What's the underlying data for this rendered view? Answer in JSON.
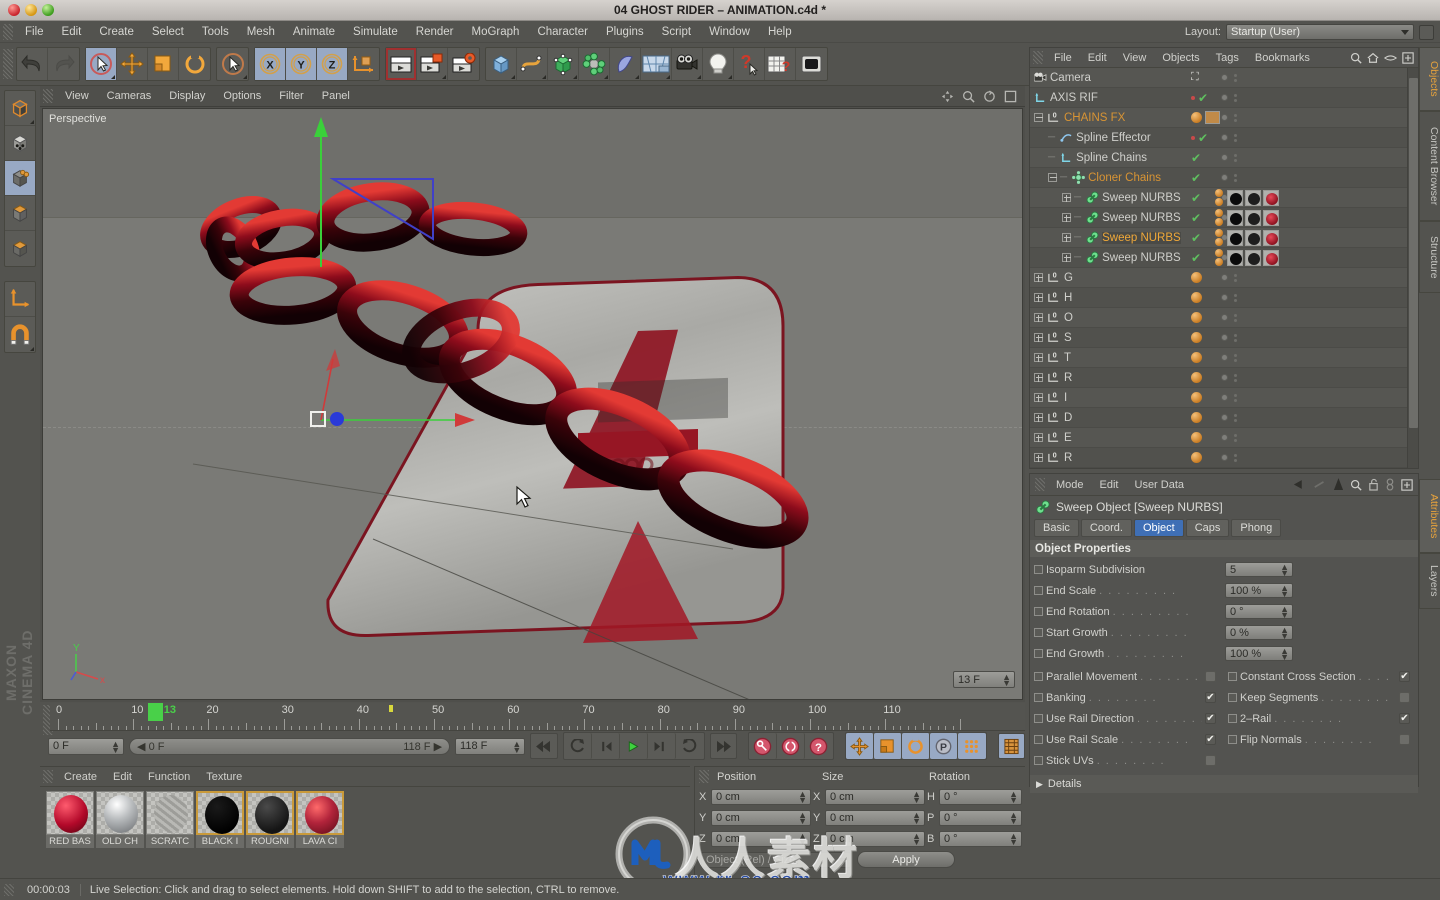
{
  "window": {
    "title": "04 GHOST RIDER – ANIMATION.c4d *",
    "traffic_lights": [
      "close",
      "minimize",
      "zoom"
    ]
  },
  "menubar": {
    "items": [
      "File",
      "Edit",
      "Create",
      "Select",
      "Tools",
      "Mesh",
      "Animate",
      "Simulate",
      "Render",
      "MoGraph",
      "Character",
      "Plugins",
      "Script",
      "Window",
      "Help"
    ],
    "layout_label": "Layout:",
    "layout_value": "Startup (User)"
  },
  "toolbar": {
    "groups": [
      {
        "name": "history",
        "buttons": [
          {
            "icon": "undo-icon",
            "label": "Undo",
            "selected": false
          },
          {
            "icon": "redo-icon",
            "label": "Redo",
            "selected": false
          }
        ]
      },
      {
        "name": "tools",
        "buttons": [
          {
            "icon": "live-selection-icon",
            "label": "Live Selection",
            "selected": true
          },
          {
            "icon": "move-icon",
            "label": "Move",
            "selected": false
          },
          {
            "icon": "scale-icon",
            "label": "Scale",
            "selected": false
          },
          {
            "icon": "rotate-icon",
            "label": "Rotate",
            "selected": false
          }
        ]
      },
      {
        "name": "selection",
        "buttons": [
          {
            "icon": "selection-mode-icon",
            "label": "Selection Mode",
            "selected": false
          }
        ]
      },
      {
        "name": "axis-lock",
        "buttons": [
          {
            "icon": "x-axis-icon",
            "label": "X Axis",
            "selected": true
          },
          {
            "icon": "y-axis-icon",
            "label": "Y Axis",
            "selected": true
          },
          {
            "icon": "z-axis-icon",
            "label": "Z Axis",
            "selected": true
          },
          {
            "icon": "world-coordinates-icon",
            "label": "World / Object Coordinates",
            "selected": false
          }
        ]
      },
      {
        "name": "render",
        "buttons": [
          {
            "icon": "render-view-icon",
            "label": "Render View",
            "selected": false
          },
          {
            "icon": "render-region-icon",
            "label": "Render to Picture Viewer",
            "selected": false
          },
          {
            "icon": "render-settings-icon",
            "label": "Render Settings",
            "selected": false
          }
        ]
      },
      {
        "name": "create",
        "buttons": [
          {
            "icon": "cube-primitive-icon",
            "label": "Add Cube Object",
            "selected": false
          },
          {
            "icon": "spline-icon",
            "label": "Add Spline",
            "selected": false
          },
          {
            "icon": "nurbs-icon",
            "label": "Add NURBS Object",
            "selected": false
          },
          {
            "icon": "array-icon",
            "label": "Add Modeling Object",
            "selected": false
          },
          {
            "icon": "deformer-icon",
            "label": "Add Deformer Object",
            "selected": false
          },
          {
            "icon": "scene-icon",
            "label": "Add Scene Object",
            "selected": false
          },
          {
            "icon": "camera-icon",
            "label": "Add Camera",
            "selected": false
          },
          {
            "icon": "light-icon",
            "label": "Add Light",
            "selected": false
          },
          {
            "icon": "help-cursor-icon",
            "label": "Context Help",
            "selected": false
          },
          {
            "icon": "table-help-icon",
            "label": "Table Help",
            "selected": false
          },
          {
            "icon": "content-folder-icon",
            "label": "Content Browser",
            "selected": false
          }
        ]
      }
    ]
  },
  "leftbar": {
    "groups": [
      {
        "buttons": [
          {
            "icon": "model-mode-icon",
            "label": "Model Mode",
            "selected": false
          },
          {
            "icon": "points-mode-icon",
            "label": "Points Mode",
            "selected": false
          },
          {
            "icon": "edges-mode-icon",
            "label": "Edges Mode",
            "selected": true
          },
          {
            "icon": "polygons-mode-icon",
            "label": "Polygons Mode",
            "selected": false
          },
          {
            "icon": "texture-mode-icon",
            "label": "Texture Mode",
            "selected": false
          }
        ]
      },
      {
        "buttons": [
          {
            "icon": "axis-modify-icon",
            "label": "Enable Axis Modification",
            "selected": false
          },
          {
            "icon": "magnet-icon",
            "label": "Snap Settings",
            "selected": false
          }
        ]
      }
    ],
    "branding": "MAXON CINEMA 4D"
  },
  "viewport": {
    "menu": [
      "View",
      "Cameras",
      "Display",
      "Options",
      "Filter",
      "Panel"
    ],
    "label": "Perspective",
    "nav_icons": [
      "pan-icon",
      "zoom-icon",
      "rotate-icon",
      "maximize-icon"
    ],
    "scene_description": "Red chain links passing through a grey metal letter A logo"
  },
  "object_manager": {
    "menu": [
      "File",
      "Edit",
      "View",
      "Objects",
      "Tags",
      "Bookmarks"
    ],
    "header_icons": [
      "search-icon",
      "home-icon",
      "eye-icon",
      "add-icon"
    ],
    "objects": [
      {
        "name": "Camera",
        "icon": "camera-icon",
        "indent": 0,
        "expander": "none",
        "color": "normal",
        "tags": [
          "frame"
        ],
        "dots": true
      },
      {
        "name": "AXIS RIF",
        "icon": "null-icon",
        "indent": 0,
        "expander": "none",
        "color": "normal",
        "tags": [
          "red",
          "check"
        ],
        "dots": true
      },
      {
        "name": "CHAINS FX",
        "icon": "layer-icon",
        "indent": 0,
        "expander": "minus",
        "color": "orange",
        "tags": [
          "sphere",
          "eye"
        ],
        "dots": true
      },
      {
        "name": "Spline Effector",
        "icon": "effector-icon",
        "indent": 1,
        "expander": "none",
        "color": "normal",
        "tags": [
          "red",
          "check"
        ],
        "dots": true
      },
      {
        "name": "Spline Chains",
        "icon": "null-icon",
        "indent": 1,
        "expander": "none",
        "color": "normal",
        "tags": [
          "check"
        ],
        "dots": true
      },
      {
        "name": "Cloner Chains",
        "icon": "cloner-icon",
        "indent": 1,
        "expander": "minus",
        "color": "orange",
        "tags": [
          "check"
        ],
        "dots": true
      },
      {
        "name": "Sweep NURBS",
        "icon": "sweep-icon",
        "indent": 2,
        "expander": "plus",
        "color": "normal",
        "tags": [
          "check",
          "spheres",
          "mats"
        ],
        "dots": true
      },
      {
        "name": "Sweep NURBS",
        "icon": "sweep-icon",
        "indent": 2,
        "expander": "plus",
        "color": "normal",
        "tags": [
          "check",
          "spheres",
          "mats"
        ],
        "dots": true
      },
      {
        "name": "Sweep NURBS",
        "icon": "sweep-icon",
        "indent": 2,
        "expander": "plus",
        "color": "orange-selected",
        "tags": [
          "check",
          "spheres",
          "mats"
        ],
        "dots": true
      },
      {
        "name": "Sweep NURBS",
        "icon": "sweep-icon",
        "indent": 2,
        "expander": "plus",
        "color": "normal",
        "tags": [
          "check",
          "spheres",
          "mats"
        ],
        "dots": true
      },
      {
        "name": "G",
        "icon": "extrude-icon",
        "indent": 0,
        "expander": "plus",
        "color": "normal",
        "tags": [
          "sphere"
        ],
        "dots": true
      },
      {
        "name": "H",
        "icon": "extrude-icon",
        "indent": 0,
        "expander": "plus",
        "color": "normal",
        "tags": [
          "sphere"
        ],
        "dots": true
      },
      {
        "name": "O",
        "icon": "extrude-icon",
        "indent": 0,
        "expander": "plus",
        "color": "normal",
        "tags": [
          "sphere"
        ],
        "dots": true
      },
      {
        "name": "S",
        "icon": "extrude-icon",
        "indent": 0,
        "expander": "plus",
        "color": "normal",
        "tags": [
          "sphere"
        ],
        "dots": true
      },
      {
        "name": "T",
        "icon": "extrude-icon",
        "indent": 0,
        "expander": "plus",
        "color": "normal",
        "tags": [
          "sphere"
        ],
        "dots": true
      },
      {
        "name": "R",
        "icon": "extrude-icon",
        "indent": 0,
        "expander": "plus",
        "color": "normal",
        "tags": [
          "sphere"
        ],
        "dots": true
      },
      {
        "name": "I",
        "icon": "extrude-icon",
        "indent": 0,
        "expander": "plus",
        "color": "normal",
        "tags": [
          "sphere"
        ],
        "dots": true
      },
      {
        "name": "D",
        "icon": "extrude-icon",
        "indent": 0,
        "expander": "plus",
        "color": "normal",
        "tags": [
          "sphere"
        ],
        "dots": true
      },
      {
        "name": "E",
        "icon": "extrude-icon",
        "indent": 0,
        "expander": "plus",
        "color": "normal",
        "tags": [
          "sphere"
        ],
        "dots": true
      },
      {
        "name": "R",
        "icon": "extrude-icon",
        "indent": 0,
        "expander": "plus",
        "color": "normal",
        "tags": [
          "sphere"
        ],
        "dots": true
      }
    ]
  },
  "attributes": {
    "menu": [
      "Mode",
      "Edit",
      "User Data"
    ],
    "header_icons": [
      "back-arrow-icon",
      "pin-icon",
      "up-arrow-icon",
      "search-icon",
      "lock-icon",
      "link-icon",
      "add-icon"
    ],
    "object_title": "Sweep Object [Sweep NURBS]",
    "object_icon": "sweep-icon",
    "tabs": [
      {
        "label": "Basic",
        "active": false
      },
      {
        "label": "Coord.",
        "active": false
      },
      {
        "label": "Object",
        "active": true
      },
      {
        "label": "Caps",
        "active": false
      },
      {
        "label": "Phong",
        "active": false
      }
    ],
    "section_title": "Object Properties",
    "numeric_properties": [
      {
        "label": "Isoparm Subdivision",
        "value": "5",
        "dots": false
      },
      {
        "label": "End Scale",
        "value": "100 %",
        "dots": true
      },
      {
        "label": "End Rotation",
        "value": "0 °",
        "dots": true
      },
      {
        "label": "Start Growth",
        "value": "0 %",
        "dots": true
      },
      {
        "label": "End Growth",
        "value": "100 %",
        "dots": true
      }
    ],
    "checkbox_left": [
      {
        "label": "Parallel Movement",
        "checked": false
      },
      {
        "label": "Banking",
        "checked": true
      },
      {
        "label": "Use Rail Direction",
        "checked": true
      },
      {
        "label": "Use Rail Scale",
        "checked": true
      },
      {
        "label": "Stick UVs",
        "checked": false
      }
    ],
    "checkbox_right": [
      {
        "label": "Constant Cross Section",
        "checked": true
      },
      {
        "label": "Keep Segments",
        "checked": false
      },
      {
        "label": "2–Rail",
        "checked": true
      },
      {
        "label": "Flip Normals",
        "checked": false
      }
    ],
    "details_label": "Details"
  },
  "right_tabs_top": [
    {
      "label": "Objects",
      "active": true
    },
    {
      "label": "Content Browser",
      "active": false
    },
    {
      "label": "Structure",
      "active": false
    }
  ],
  "right_tabs_bottom": [
    {
      "label": "Attributes",
      "active": true
    },
    {
      "label": "Layers",
      "active": false
    }
  ],
  "timeline": {
    "tick_labels": [
      "0",
      "10",
      "20",
      "30",
      "40",
      "50",
      "60",
      "70",
      "80",
      "90",
      "100",
      "110"
    ],
    "current_frame_label": "13",
    "range_start": "0 F",
    "preview_start": "0 F",
    "preview_end": "118 F",
    "doc_end": "118 F",
    "frame_field": "13 F",
    "transport_buttons": [
      {
        "icon": "go-to-start-icon",
        "label": "Go to Start"
      },
      {
        "icon": "step-back-keyframe-icon",
        "label": "Go to Previous Key"
      },
      {
        "icon": "step-back-icon",
        "label": "Go to Previous Frame"
      },
      {
        "icon": "play-icon",
        "label": "Play Forwards"
      },
      {
        "icon": "step-forward-icon",
        "label": "Go to Next Frame"
      },
      {
        "icon": "step-forward-keyframe-icon",
        "label": "Go to Next Key"
      },
      {
        "icon": "go-to-end-icon",
        "label": "Go to End"
      }
    ],
    "record_buttons": [
      {
        "icon": "record-key-icon",
        "label": "Record Active Objects"
      },
      {
        "icon": "autokey-icon",
        "label": "Autokeying"
      },
      {
        "icon": "keyframe-selection-icon",
        "label": "Keyframe Selection"
      }
    ],
    "param_buttons": [
      {
        "icon": "position-key-icon",
        "label": "Position",
        "on": true
      },
      {
        "icon": "scale-key-icon",
        "label": "Scale",
        "on": true
      },
      {
        "icon": "rotation-key-icon",
        "label": "Rotation",
        "on": true
      },
      {
        "icon": "parameter-key-icon",
        "label": "Parameter",
        "on": true
      },
      {
        "icon": "pla-key-icon",
        "label": "Point Level Animation",
        "on": true
      }
    ],
    "extra_button": {
      "icon": "timeline-icon",
      "label": "Open Timeline"
    }
  },
  "material_manager": {
    "menu": [
      "Create",
      "Edit",
      "Function",
      "Texture"
    ],
    "materials": [
      {
        "name": "RED BAS",
        "color": "#b3092a",
        "selected": false,
        "kind": "glossy"
      },
      {
        "name": "OLD CH",
        "color": "#b9bcbe",
        "selected": false,
        "kind": "metal"
      },
      {
        "name": "SCRATC",
        "color": "#a9a9a5",
        "selected": false,
        "kind": "scratch"
      },
      {
        "name": "BLACK I",
        "color": "#0a0a0a",
        "selected": true,
        "kind": "flat"
      },
      {
        "name": "ROUGNI",
        "color": "#222222",
        "selected": true,
        "kind": "rough"
      },
      {
        "name": "LAVA CI",
        "color": "#b2243b",
        "selected": true,
        "kind": "lava"
      }
    ]
  },
  "coordinates": {
    "columns": [
      "Position",
      "Size",
      "Rotation"
    ],
    "rows": [
      {
        "axis": "X",
        "position": "0 cm",
        "size_axis": "X",
        "size": "0 cm",
        "rot_axis": "H",
        "rotation": "0 °"
      },
      {
        "axis": "Y",
        "position": "0 cm",
        "size_axis": "Y",
        "size": "0 cm",
        "rot_axis": "P",
        "rotation": "0 °"
      },
      {
        "axis": "Z",
        "position": "0 cm",
        "size_axis": "Z",
        "size": "0 cm",
        "rot_axis": "B",
        "rotation": "0 °"
      }
    ],
    "mode_value": "Object (Rel) / Size",
    "apply_label": "Apply"
  },
  "statusbar": {
    "time": "00:00:03",
    "message": "Live Selection: Click and drag to select elements. Hold down SHIFT to add to the selection, CTRL to remove."
  },
  "watermark": {
    "cn_text": "人人素材",
    "url": "www.rr-sc.com"
  }
}
